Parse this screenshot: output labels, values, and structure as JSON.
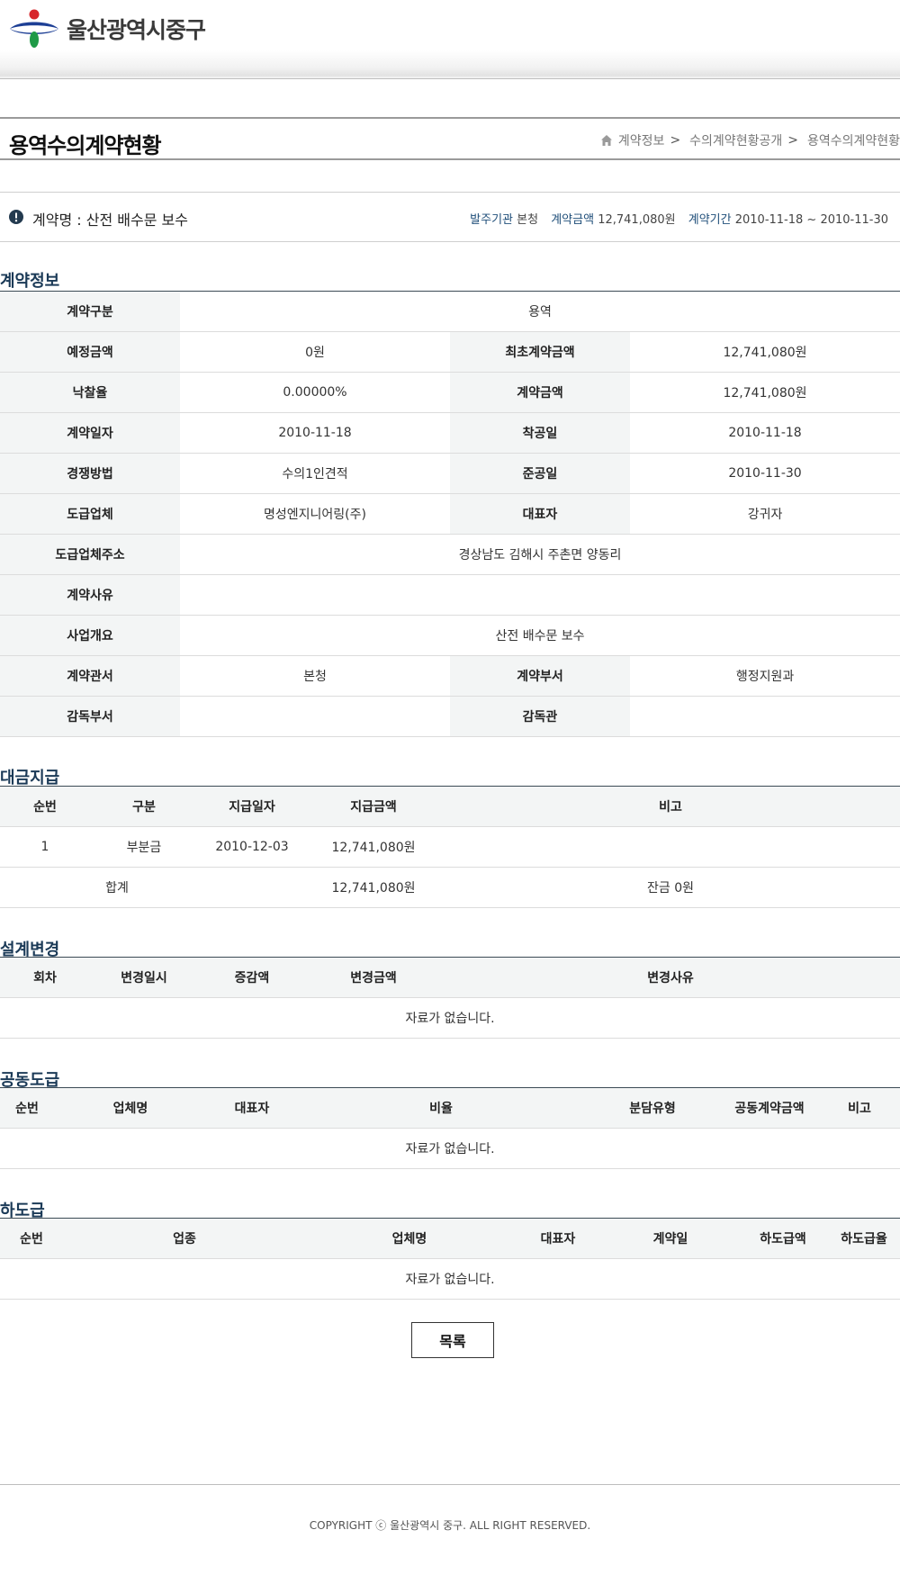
{
  "header": {
    "logo_text": "울산광역시중구",
    "colors": {
      "red": "#d7262b",
      "blue": "#1d3f95",
      "green": "#1f9a47"
    }
  },
  "title": {
    "page_title": "용역수의계약현황",
    "breadcrumb": [
      "계약정보",
      "수의계약현황공개",
      "용역수의계약현황"
    ],
    "separator": ">"
  },
  "summary": {
    "contract_name_label": "계약명 : 산전 배수문 보수",
    "org_label": "발주기관",
    "org_value": "본청",
    "amount_label": "계약금액",
    "amount_value": "12,741,080원",
    "period_label": "계약기간",
    "period_value": "2010-11-18 ~ 2010-11-30"
  },
  "contract_info": {
    "section_title": "계약정보",
    "category_label": "계약구분",
    "category_value": "용역",
    "estimated_label": "예정금액",
    "estimated_value": "0원",
    "initial_amount_label": "최초계약금액",
    "initial_amount_value": "12,741,080원",
    "rate_label": "낙찰율",
    "rate_value": "0.00000%",
    "amount_label": "계약금액",
    "amount_value": "12,741,080원",
    "date_label": "계약일자",
    "date_value": "2010-11-18",
    "start_label": "착공일",
    "start_value": "2010-11-18",
    "method_label": "경쟁방법",
    "method_value": "수의1인견적",
    "finish_label": "준공일",
    "finish_value": "2010-11-30",
    "company_label": "도급업체",
    "company_value": "명성엔지니어링(주)",
    "ceo_label": "대표자",
    "ceo_value": "강귀자",
    "address_label": "도급업체주소",
    "address_value": "경상남도 김해시 주촌면 양동리",
    "reason_label": "계약사유",
    "reason_value": "",
    "overview_label": "사업개요",
    "overview_value": "산전 배수문 보수",
    "office_label": "계약관서",
    "office_value": "본청",
    "dept_label": "계약부서",
    "dept_value": "행정지원과",
    "supervisor_dept_label": "감독부서",
    "supervisor_dept_value": "",
    "supervisor_label": "감독관",
    "supervisor_value": ""
  },
  "payment": {
    "section_title": "대금지급",
    "headers": [
      "순번",
      "구분",
      "지급일자",
      "지급금액",
      "비고"
    ],
    "rows": [
      [
        "1",
        "부분금",
        "2010-12-03",
        "12,741,080원",
        ""
      ]
    ],
    "total_label": "합계",
    "total_amount": "12,741,080원",
    "balance": "잔금 0원"
  },
  "design_change": {
    "section_title": "설계변경",
    "headers": [
      "회차",
      "변경일시",
      "증감액",
      "변경금액",
      "변경사유"
    ],
    "empty": "자료가 없습니다."
  },
  "joint": {
    "section_title": "공동도급",
    "headers": [
      "순번",
      "업체명",
      "대표자",
      "비율",
      "분담유형",
      "공동계약금액",
      "비고"
    ],
    "empty": "자료가 없습니다."
  },
  "subcontract": {
    "section_title": "하도급",
    "headers": [
      "순번",
      "업종",
      "업체명",
      "대표자",
      "계약일",
      "하도급액",
      "하도급율"
    ],
    "empty": "자료가 없습니다."
  },
  "list_button": "목록",
  "footer": {
    "copyright": "COPYRIGHT ⓒ 울산광역시 중구. ALL RIGHT RESERVED."
  }
}
